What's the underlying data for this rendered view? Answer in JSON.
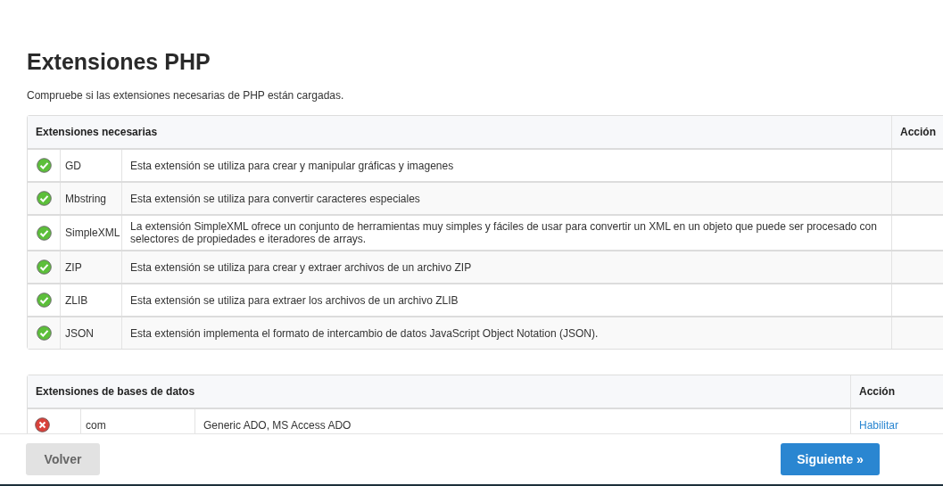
{
  "title": "Extensiones PHP",
  "description": "Compruebe si las extensiones necesarias de PHP están cargadas.",
  "tables": [
    {
      "heading": "Extensiones necesarias",
      "action_heading": "Acción",
      "rows": [
        {
          "loaded": true,
          "name": "GD",
          "description": "Esta extensión se utiliza para crear y manipular gráficas y imagenes"
        },
        {
          "loaded": true,
          "name": "Mbstring",
          "description": "Esta extensión se utiliza para convertir caracteres especiales"
        },
        {
          "loaded": true,
          "name": "SimpleXML",
          "description": "La extensión SimpleXML ofrece un conjunto de herramientas muy simples y fáciles de usar para convertir un XML en un objeto que puede ser procesado con selectores de propiedades e iteradores de arrays."
        },
        {
          "loaded": true,
          "name": "ZIP",
          "description": "Esta extensión se utiliza para crear y extraer archivos de un archivo ZIP"
        },
        {
          "loaded": true,
          "name": "ZLIB",
          "description": "Esta extensión se utiliza para extraer los archivos de un archivo ZLIB"
        },
        {
          "loaded": true,
          "name": "JSON",
          "description": "Esta extensión implementa el formato de intercambio de datos JavaScript Object Notation (JSON)."
        }
      ]
    },
    {
      "heading": "Extensiones de bases de datos",
      "action_heading": "Acción",
      "rows": [
        {
          "loaded": false,
          "name": "com",
          "description": "Generic ADO, MS Access ADO",
          "action": "Habilitar"
        }
      ]
    }
  ],
  "buttons": {
    "back": "Volver",
    "next": "Siguiente »"
  }
}
